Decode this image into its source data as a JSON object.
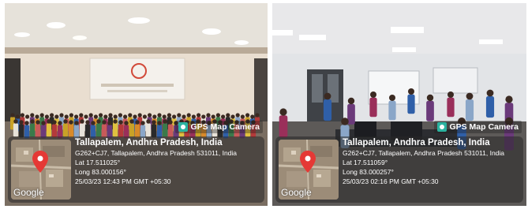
{
  "photos": [
    {
      "gps_badge": "GPS Map Camera",
      "place": "Tallapalem, Andhra Pradesh, India",
      "address": "G262+CJ7, Tallapalem, Andhra Pradesh 531011, India",
      "lat": "Lat 17.511025°",
      "long": "Long 83.000156°",
      "datetime": "25/03/23 12:43 PM GMT +05:30",
      "map_logo": "Google"
    },
    {
      "gps_badge": "GPS Map Camera",
      "place": "Tallapalem, Andhra Pradesh, India",
      "address": "G262+CJ7, Tallapalem, Andhra Pradesh 531011, India",
      "lat": "Lat 17.511059°",
      "long": "Long 83.000257°",
      "datetime": "25/03/23 02:16 PM GMT +05:30",
      "map_logo": "Google"
    }
  ],
  "colors": {
    "map_pin": "#e53935",
    "gps_icon": "#2bb3a0"
  }
}
